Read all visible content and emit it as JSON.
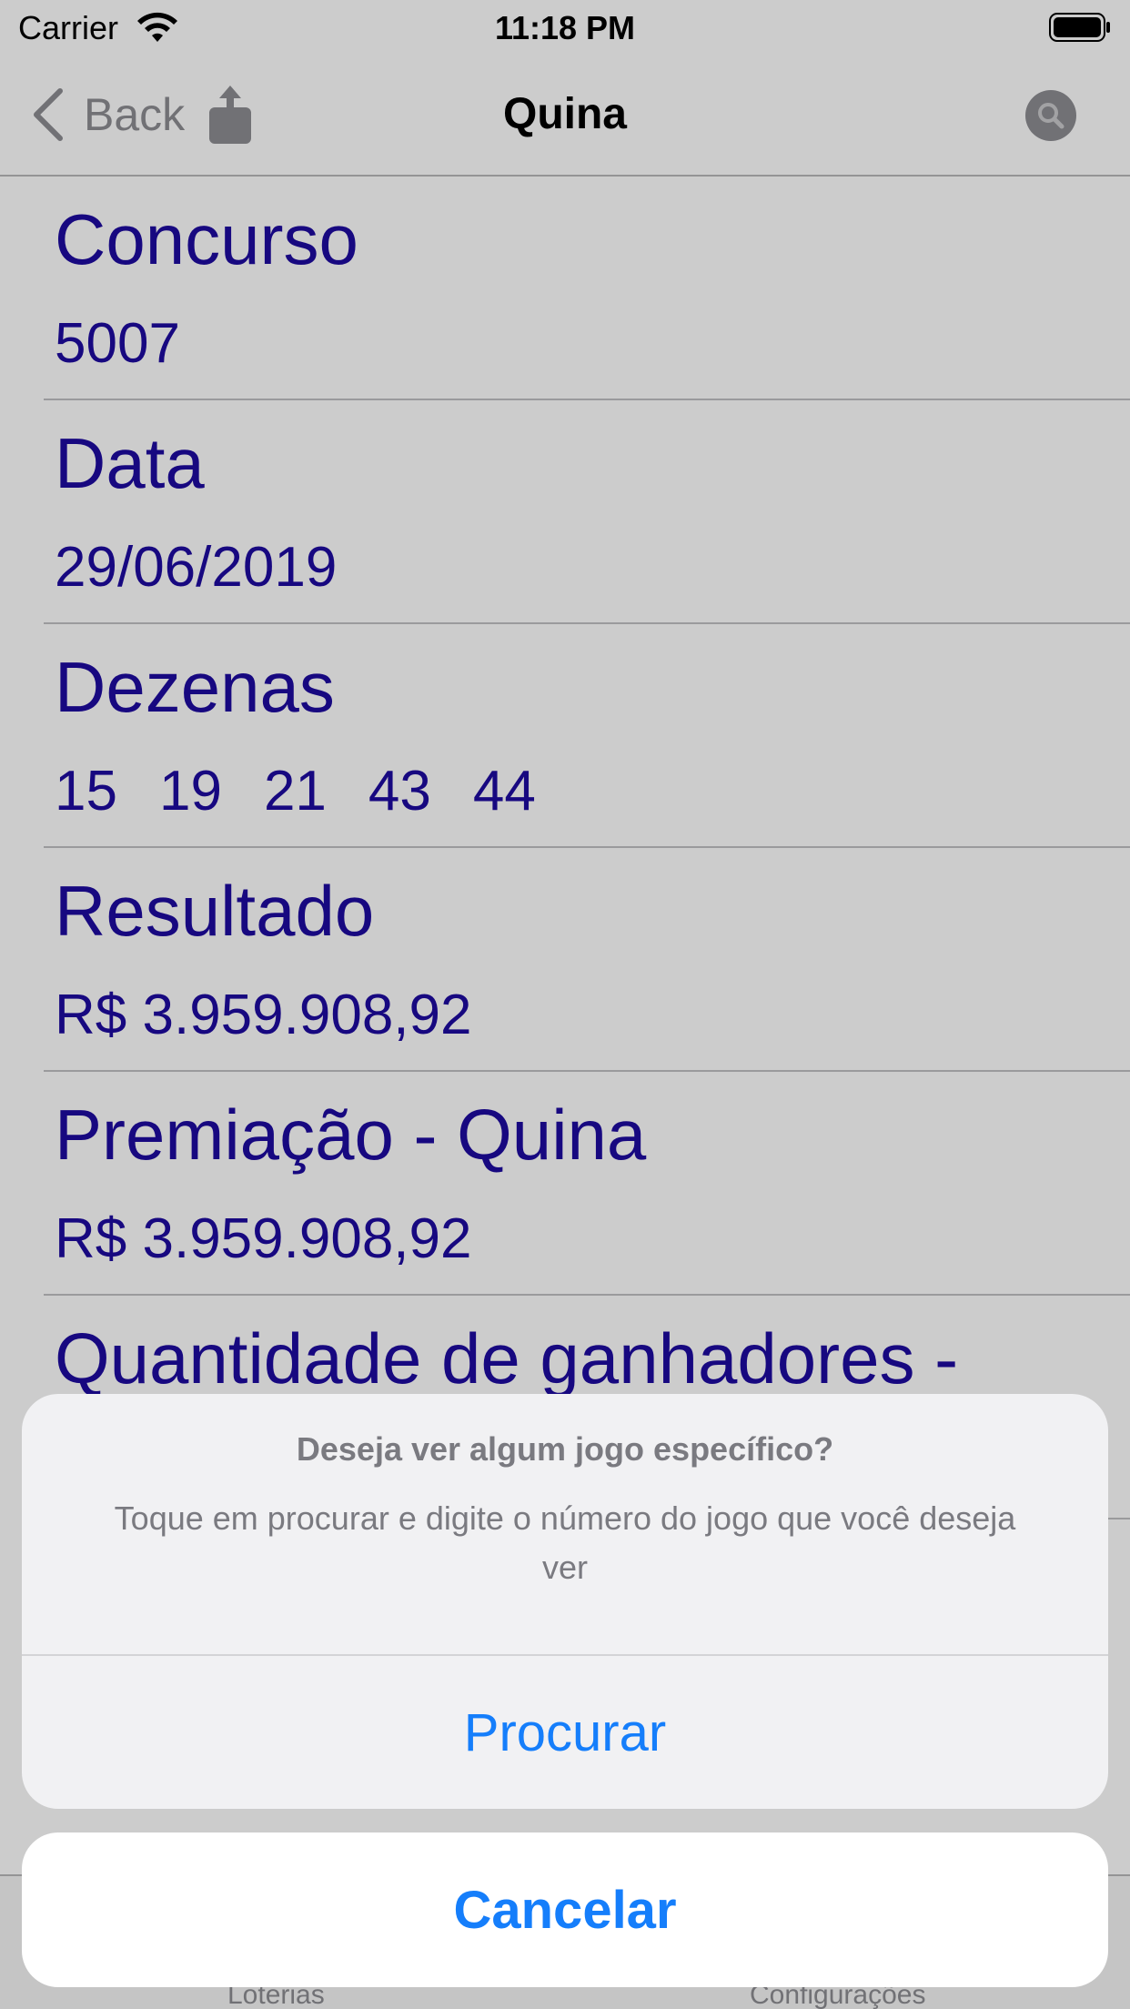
{
  "status_bar": {
    "carrier": "Carrier",
    "time": "11:18 PM"
  },
  "nav": {
    "back_label": "Back",
    "title": "Quina"
  },
  "rows": [
    {
      "label": "Concurso",
      "value": "5007"
    },
    {
      "label": "Data",
      "value": "29/06/2019"
    },
    {
      "label": "Dezenas",
      "numbers": [
        "15",
        "19",
        "21",
        "43",
        "44"
      ]
    },
    {
      "label": "Resultado",
      "value": "R$ 3.959.908,92"
    },
    {
      "label": "Premiação - Quina",
      "value": "R$ 3.959.908,92"
    },
    {
      "label": "Quantidade de ganhadores -"
    }
  ],
  "tab_bar": {
    "items": [
      {
        "label": "Loterias"
      },
      {
        "label": "Configurações"
      }
    ]
  },
  "action_sheet": {
    "title": "Deseja ver algum jogo específico?",
    "message": "Toque em procurar e digite o número do jogo que você deseja ver",
    "action_label": "Procurar",
    "cancel_label": "Cancelar"
  },
  "colors": {
    "text_primary": "#1d0aa0",
    "ios_blue": "#157efb",
    "overlay": "rgba(0,0,0,0.2)"
  },
  "icons": [
    "wifi-icon",
    "battery-icon",
    "back-chevron-icon",
    "share-icon",
    "search-icon"
  ]
}
